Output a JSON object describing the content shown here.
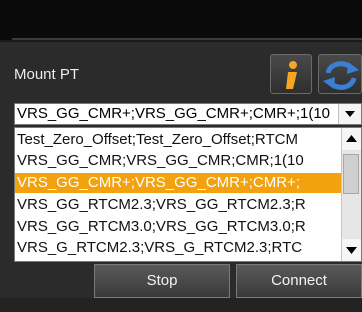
{
  "mount": {
    "label": "Mount PT",
    "selected_value": "VRS_GG_CMR+;VRS_GG_CMR+;CMR+;1(10"
  },
  "icons": {
    "info": "info-icon",
    "sync": "sync-arrows-icon",
    "dropdown": "chevron-down-icon",
    "scroll_up": "chevron-up-icon",
    "scroll_down": "chevron-down-icon"
  },
  "list": {
    "items": [
      "Test_Zero_Offset;Test_Zero_Offset;RTCM",
      "VRS_GG_CMR;VRS_GG_CMR;CMR;1(10",
      "VRS_GG_CMR+;VRS_GG_CMR+;CMR+;",
      "VRS_GG_RTCM2.3;VRS_GG_RTCM2.3;R",
      "VRS_GG_RTCM3.0;VRS_GG_RTCM3.0;R",
      "VRS_G_RTCM2.3;VRS_G_RTCM2.3;RTC"
    ],
    "selected_index": 2
  },
  "buttons": {
    "stop": "Stop",
    "connect": "Connect"
  },
  "colors": {
    "selection": "#f2a20f",
    "panel": "#2b2b2b",
    "info_icon": "#f5a623",
    "sync_icon": "#3a7fd4"
  }
}
